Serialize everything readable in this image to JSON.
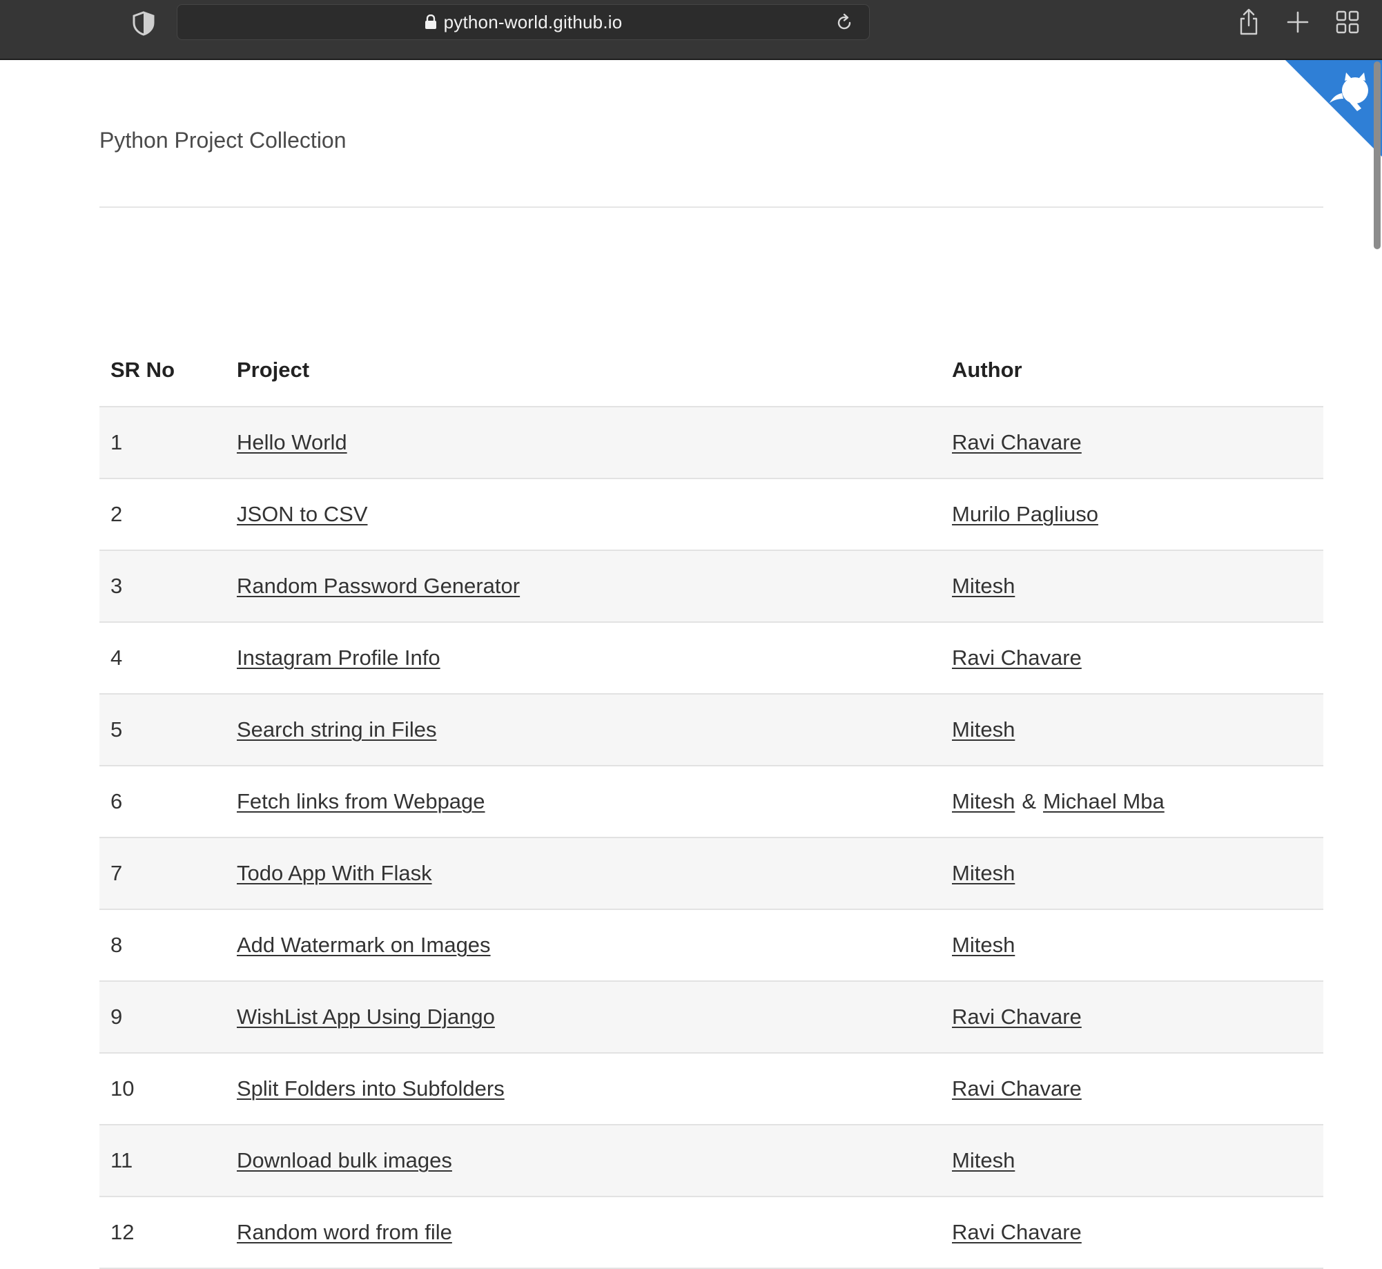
{
  "browser": {
    "url": "python-world.github.io"
  },
  "page": {
    "title": "Python Project Collection"
  },
  "table": {
    "headers": {
      "sr": "SR No",
      "project": "Project",
      "author": "Author"
    },
    "rows": [
      {
        "sr": "1",
        "project": "Hello World",
        "authors": [
          "Ravi Chavare"
        ]
      },
      {
        "sr": "2",
        "project": "JSON to CSV",
        "authors": [
          "Murilo Pagliuso"
        ]
      },
      {
        "sr": "3",
        "project": "Random Password Generator",
        "authors": [
          "Mitesh"
        ]
      },
      {
        "sr": "4",
        "project": "Instagram Profile Info",
        "authors": [
          "Ravi Chavare"
        ]
      },
      {
        "sr": "5",
        "project": "Search string in Files",
        "authors": [
          "Mitesh"
        ]
      },
      {
        "sr": "6",
        "project": "Fetch links from Webpage",
        "authors": [
          "Mitesh",
          "Michael Mba"
        ],
        "author_separator": "&"
      },
      {
        "sr": "7",
        "project": "Todo App With Flask",
        "authors": [
          "Mitesh"
        ]
      },
      {
        "sr": "8",
        "project": "Add Watermark on Images",
        "authors": [
          "Mitesh"
        ]
      },
      {
        "sr": "9",
        "project": "WishList App Using Django",
        "authors": [
          "Ravi Chavare"
        ]
      },
      {
        "sr": "10",
        "project": "Split Folders into Subfolders",
        "authors": [
          "Ravi Chavare"
        ]
      },
      {
        "sr": "11",
        "project": "Download bulk images",
        "authors": [
          "Mitesh"
        ]
      },
      {
        "sr": "12",
        "project": "Random word from file",
        "authors": [
          "Ravi Chavare"
        ]
      }
    ]
  },
  "colors": {
    "toolbar_bg": "#363636",
    "corner_ribbon": "#2f7fd6",
    "row_stripe": "#f6f6f6",
    "text": "#333333"
  },
  "icons": {
    "shield": "shield-icon",
    "lock": "lock-icon",
    "reload": "reload-icon",
    "share": "share-icon",
    "new_tab": "plus-icon",
    "tab_overview": "tab-grid-icon",
    "github_corner": "github-octocat-icon"
  }
}
